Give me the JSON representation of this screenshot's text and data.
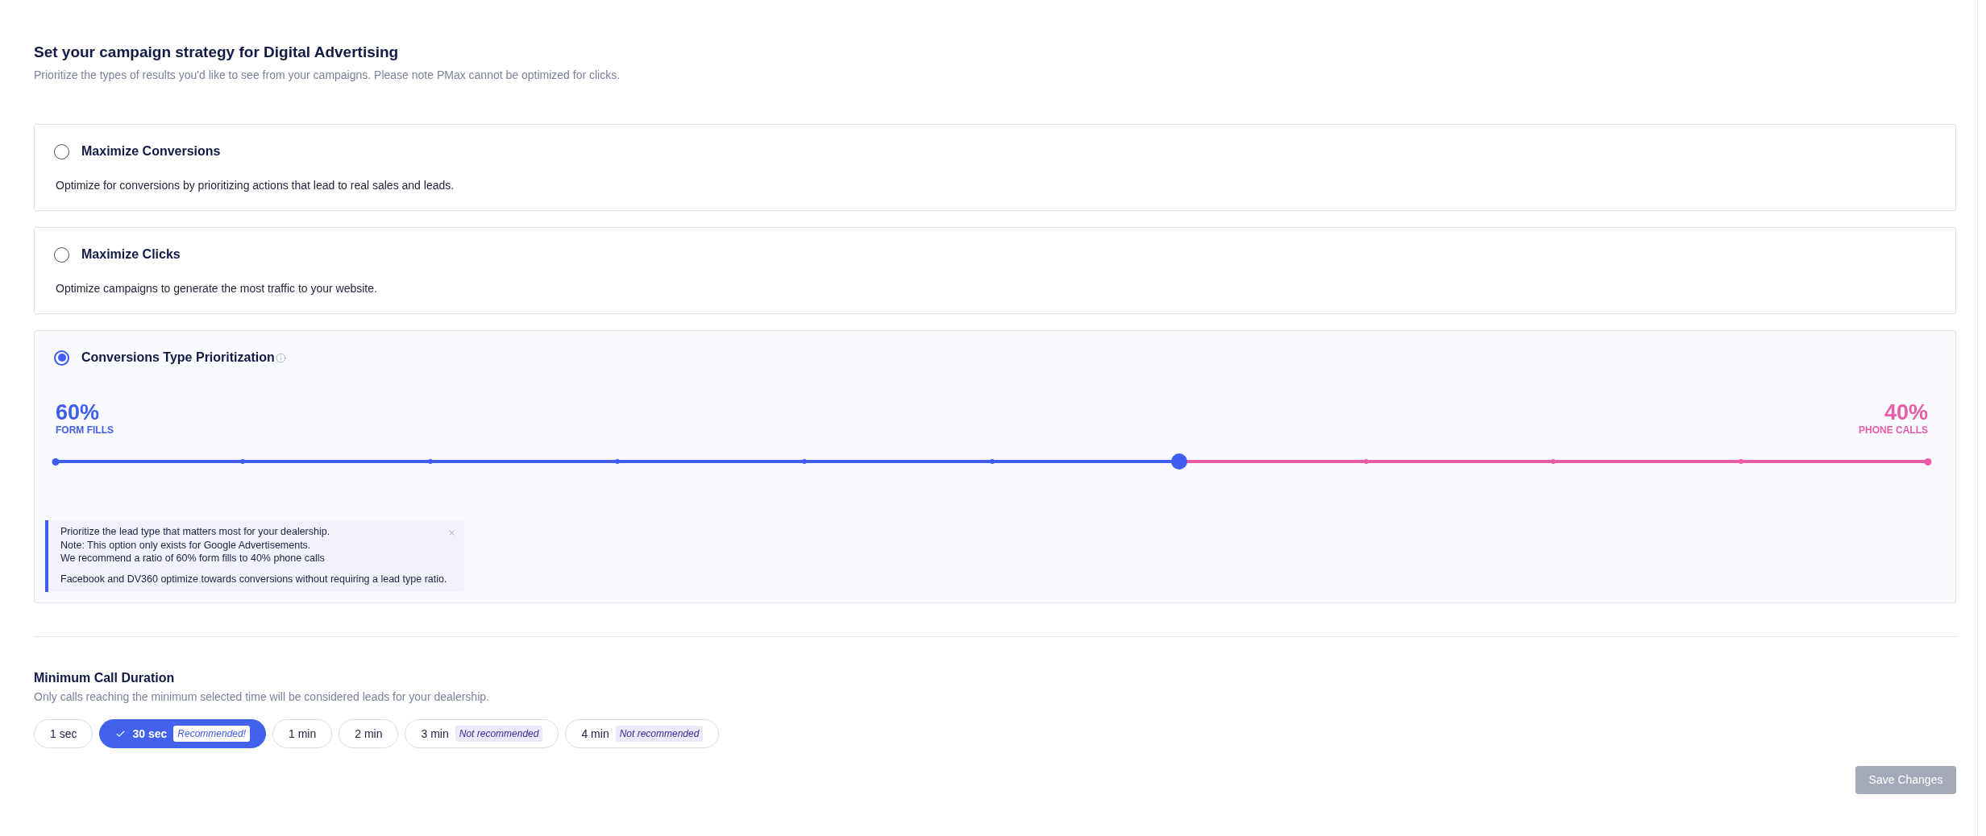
{
  "header": {
    "title": "Set your campaign strategy for Digital Advertising",
    "subtitle": "Prioritize the types of results you'd like to see from your campaigns. Please note PMax cannot be optimized for clicks."
  },
  "strategies": [
    {
      "kind": "simple",
      "title": "Maximize Conversions",
      "selected": false,
      "description": "Optimize for conversions by prioritizing actions that lead to real sales and leads."
    },
    {
      "kind": "simple",
      "title": "Maximize Clicks",
      "selected": false,
      "description": "Optimize campaigns to generate the most traffic to your website."
    },
    {
      "kind": "ratio",
      "title": "Conversions Type Prioritization",
      "selected": true,
      "slider": {
        "sides": [
          {
            "percent": "60%",
            "label": "FORM FILLS"
          },
          {
            "percent": "40%",
            "label": "PHONE CALLS"
          }
        ],
        "level": 0.6
      },
      "note": {
        "lines": [
          "Prioritize the lead type that matters most for your dealership.",
          "Note: This option only exists for Google Advertisements.",
          "We recommend a ratio of 60% form fills to 40% phone calls"
        ],
        "footer": "Facebook and DV360 optimize towards conversions without requiring a lead type ratio."
      }
    }
  ],
  "call_duration": {
    "title": "Minimum Call Duration",
    "subtitle": "Only calls reaching the minimum selected time will be considered leads for your dealership.",
    "options": [
      {
        "label": "1 sec",
        "selected": false
      },
      {
        "label": "30 sec",
        "selected": true,
        "badge": {
          "kind": "recommended",
          "text": "Recommended!"
        }
      },
      {
        "label": "1 min",
        "selected": false
      },
      {
        "label": "2 min",
        "selected": false
      },
      {
        "label": "3 min",
        "selected": false,
        "badge": {
          "kind": "discouraged",
          "text": "Not recommended"
        }
      },
      {
        "label": "4 min",
        "selected": false,
        "badge": {
          "kind": "discouraged",
          "text": "Not recommended"
        }
      }
    ]
  },
  "save_button": {
    "label": "Save Changes",
    "disabled": true
  }
}
